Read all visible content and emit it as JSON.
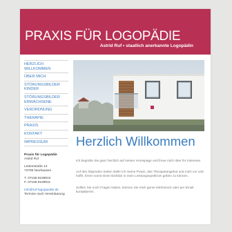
{
  "header": {
    "title": "PRAXIS FÜR LOGOPÄDIE",
    "subtitle": "Astrid Ruf • staatlich anerkannte Logopädin"
  },
  "nav": {
    "items": [
      {
        "label": "HERZLICH\nWILLKOMMEN"
      },
      {
        "label": "ÜBER MICH"
      },
      {
        "label": "STÖRUNGSBILDER\nKINDER"
      },
      {
        "label": "STÖRUNGSBILDER\nERWACHSENE"
      },
      {
        "label": "VERORDNUNG"
      },
      {
        "label": "THERAPIE"
      },
      {
        "label": "PRAXIS"
      },
      {
        "label": "KONTAKT"
      },
      {
        "label": "IMPRESSUM"
      }
    ]
  },
  "contact": {
    "name": "Praxis für Logopädie",
    "person": "Astrid Ruf",
    "street": "Lettenstraße 14",
    "city": "73765 Neuhausen",
    "phone": "T. 07158.9169910",
    "fax": "F. 07158.9169911",
    "email": "info@ruf-logopaedie.de",
    "note": "Termine nach Vereinbarung"
  },
  "main": {
    "title": "Herzlich Willkommen",
    "paragraphs": [
      "Ich begrüße Sie ganz herzlich auf meiner Homepage und freue mich über Ihr Interesse.",
      "Auf den folgenden Seiten stelle ich meine Praxis, das Therapieangebot und mich vor und hoffe, Ihnen somit einen Einblick in mein Leistungsspektrum geben zu können.",
      "Sollten Sie noch Fragen haben, können Sie mich gerne telefonisch oder per Email kontaktieren."
    ]
  },
  "colors": {
    "brand": "#b83054",
    "link": "#3a7cc0",
    "background": "#e6e6e4"
  }
}
